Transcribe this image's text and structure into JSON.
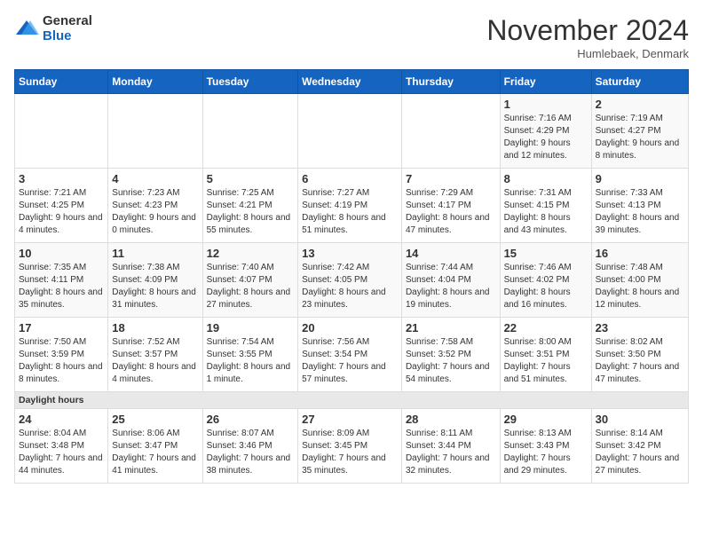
{
  "logo": {
    "general": "General",
    "blue": "Blue"
  },
  "title": "November 2024",
  "location": "Humlebaek, Denmark",
  "days_of_week": [
    "Sunday",
    "Monday",
    "Tuesday",
    "Wednesday",
    "Thursday",
    "Friday",
    "Saturday"
  ],
  "weeks": [
    [
      {
        "day": "",
        "info": ""
      },
      {
        "day": "",
        "info": ""
      },
      {
        "day": "",
        "info": ""
      },
      {
        "day": "",
        "info": ""
      },
      {
        "day": "",
        "info": ""
      },
      {
        "day": "1",
        "info": "Sunrise: 7:16 AM\nSunset: 4:29 PM\nDaylight: 9 hours and 12 minutes."
      },
      {
        "day": "2",
        "info": "Sunrise: 7:19 AM\nSunset: 4:27 PM\nDaylight: 9 hours and 8 minutes."
      }
    ],
    [
      {
        "day": "3",
        "info": "Sunrise: 7:21 AM\nSunset: 4:25 PM\nDaylight: 9 hours and 4 minutes."
      },
      {
        "day": "4",
        "info": "Sunrise: 7:23 AM\nSunset: 4:23 PM\nDaylight: 9 hours and 0 minutes."
      },
      {
        "day": "5",
        "info": "Sunrise: 7:25 AM\nSunset: 4:21 PM\nDaylight: 8 hours and 55 minutes."
      },
      {
        "day": "6",
        "info": "Sunrise: 7:27 AM\nSunset: 4:19 PM\nDaylight: 8 hours and 51 minutes."
      },
      {
        "day": "7",
        "info": "Sunrise: 7:29 AM\nSunset: 4:17 PM\nDaylight: 8 hours and 47 minutes."
      },
      {
        "day": "8",
        "info": "Sunrise: 7:31 AM\nSunset: 4:15 PM\nDaylight: 8 hours and 43 minutes."
      },
      {
        "day": "9",
        "info": "Sunrise: 7:33 AM\nSunset: 4:13 PM\nDaylight: 8 hours and 39 minutes."
      }
    ],
    [
      {
        "day": "10",
        "info": "Sunrise: 7:35 AM\nSunset: 4:11 PM\nDaylight: 8 hours and 35 minutes."
      },
      {
        "day": "11",
        "info": "Sunrise: 7:38 AM\nSunset: 4:09 PM\nDaylight: 8 hours and 31 minutes."
      },
      {
        "day": "12",
        "info": "Sunrise: 7:40 AM\nSunset: 4:07 PM\nDaylight: 8 hours and 27 minutes."
      },
      {
        "day": "13",
        "info": "Sunrise: 7:42 AM\nSunset: 4:05 PM\nDaylight: 8 hours and 23 minutes."
      },
      {
        "day": "14",
        "info": "Sunrise: 7:44 AM\nSunset: 4:04 PM\nDaylight: 8 hours and 19 minutes."
      },
      {
        "day": "15",
        "info": "Sunrise: 7:46 AM\nSunset: 4:02 PM\nDaylight: 8 hours and 16 minutes."
      },
      {
        "day": "16",
        "info": "Sunrise: 7:48 AM\nSunset: 4:00 PM\nDaylight: 8 hours and 12 minutes."
      }
    ],
    [
      {
        "day": "17",
        "info": "Sunrise: 7:50 AM\nSunset: 3:59 PM\nDaylight: 8 hours and 8 minutes."
      },
      {
        "day": "18",
        "info": "Sunrise: 7:52 AM\nSunset: 3:57 PM\nDaylight: 8 hours and 4 minutes."
      },
      {
        "day": "19",
        "info": "Sunrise: 7:54 AM\nSunset: 3:55 PM\nDaylight: 8 hours and 1 minute."
      },
      {
        "day": "20",
        "info": "Sunrise: 7:56 AM\nSunset: 3:54 PM\nDaylight: 7 hours and 57 minutes."
      },
      {
        "day": "21",
        "info": "Sunrise: 7:58 AM\nSunset: 3:52 PM\nDaylight: 7 hours and 54 minutes."
      },
      {
        "day": "22",
        "info": "Sunrise: 8:00 AM\nSunset: 3:51 PM\nDaylight: 7 hours and 51 minutes."
      },
      {
        "day": "23",
        "info": "Sunrise: 8:02 AM\nSunset: 3:50 PM\nDaylight: 7 hours and 47 minutes."
      }
    ],
    [
      {
        "day": "24",
        "info": "Sunrise: 8:04 AM\nSunset: 3:48 PM\nDaylight: 7 hours and 44 minutes."
      },
      {
        "day": "25",
        "info": "Sunrise: 8:06 AM\nSunset: 3:47 PM\nDaylight: 7 hours and 41 minutes."
      },
      {
        "day": "26",
        "info": "Sunrise: 8:07 AM\nSunset: 3:46 PM\nDaylight: 7 hours and 38 minutes."
      },
      {
        "day": "27",
        "info": "Sunrise: 8:09 AM\nSunset: 3:45 PM\nDaylight: 7 hours and 35 minutes."
      },
      {
        "day": "28",
        "info": "Sunrise: 8:11 AM\nSunset: 3:44 PM\nDaylight: 7 hours and 32 minutes."
      },
      {
        "day": "29",
        "info": "Sunrise: 8:13 AM\nSunset: 3:43 PM\nDaylight: 7 hours and 29 minutes."
      },
      {
        "day": "30",
        "info": "Sunrise: 8:14 AM\nSunset: 3:42 PM\nDaylight: 7 hours and 27 minutes."
      }
    ]
  ],
  "daylight_label": "Daylight hours"
}
